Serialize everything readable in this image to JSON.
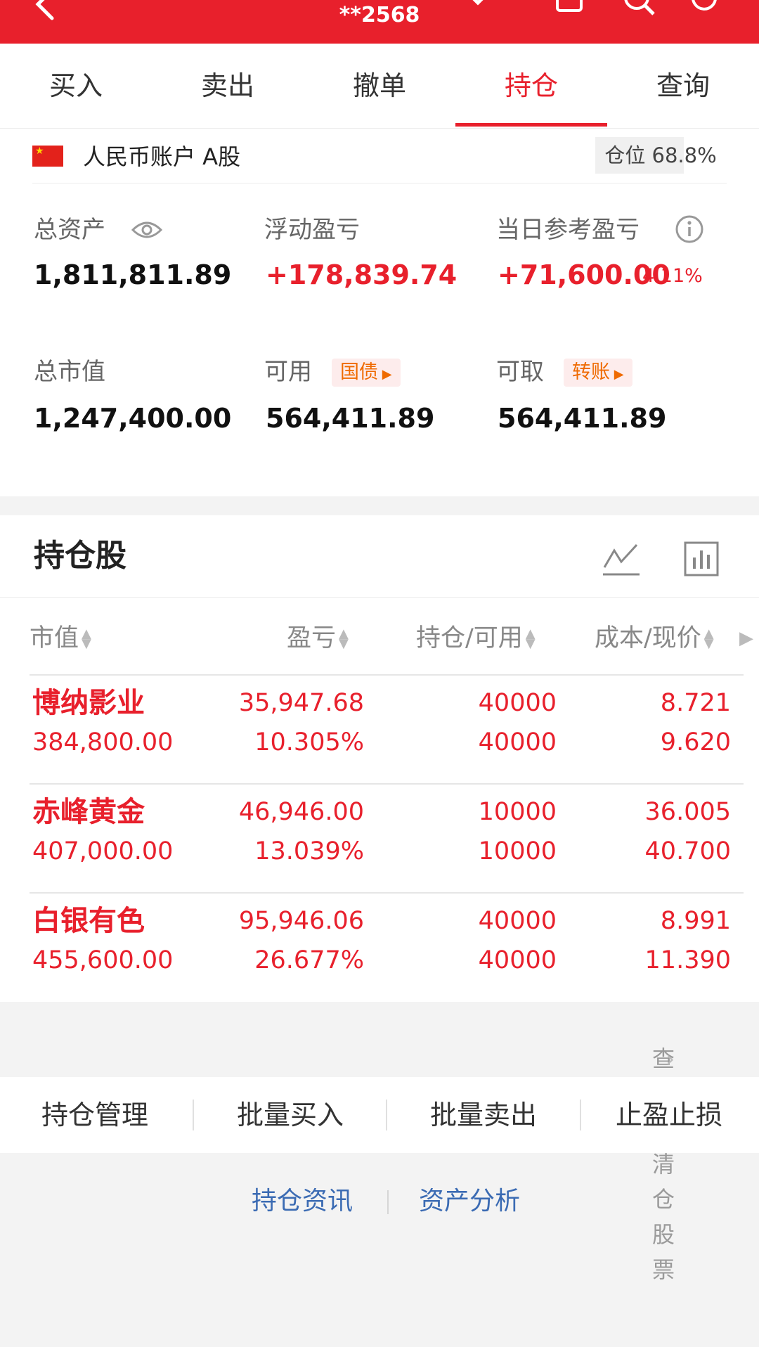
{
  "header": {
    "account_masked": "**2568",
    "icons": [
      "back-arrow-icon",
      "chevron-down-icon",
      "message-icon",
      "search-icon",
      "refresh-icon"
    ]
  },
  "tabs": [
    {
      "label": "买入"
    },
    {
      "label": "卖出"
    },
    {
      "label": "撤单"
    },
    {
      "label": "持仓",
      "active": true
    },
    {
      "label": "查询"
    }
  ],
  "account": {
    "name": "人民币账户 A股",
    "position_label": "仓位 68.8%"
  },
  "summary": {
    "total_assets_label": "总资产",
    "total_assets": "1,811,811.89",
    "floating_pl_label": "浮动盈亏",
    "floating_pl": "+178,839.74",
    "daily_pl_label": "当日参考盈亏",
    "daily_pl": "+71,600.00",
    "daily_pl_pct": "4.11%",
    "market_value_label": "总市值",
    "market_value": "1,247,400.00",
    "available_label": "可用",
    "available_tag": "国债",
    "available": "564,411.89",
    "withdrawable_label": "可取",
    "withdrawable_tag": "转账",
    "withdrawable": "564,411.89"
  },
  "holdings": {
    "title": "持仓股",
    "columns": [
      "市值",
      "盈亏",
      "持仓/可用",
      "成本/现价"
    ],
    "rows": [
      {
        "name": "博纳影业",
        "market_value": "384,800.00",
        "pl": "35,947.68",
        "pl_pct": "10.305%",
        "position": "40000",
        "available": "40000",
        "cost": "8.721",
        "price": "9.620"
      },
      {
        "name": "赤峰黄金",
        "market_value": "407,000.00",
        "pl": "46,946.00",
        "pl_pct": "13.039%",
        "position": "10000",
        "available": "10000",
        "cost": "36.005",
        "price": "40.700"
      },
      {
        "name": "白银有色",
        "market_value": "455,600.00",
        "pl": "95,946.06",
        "pl_pct": "26.677%",
        "position": "40000",
        "available": "40000",
        "cost": "8.991",
        "price": "11.390"
      }
    ],
    "cleared_link": "查看已清仓股票"
  },
  "actions": [
    "持仓管理",
    "批量买入",
    "批量卖出",
    "止盈止损"
  ],
  "links": [
    "持仓资讯",
    "资产分析"
  ],
  "colors": {
    "brand_red": "#e8202c",
    "link_blue": "#3b6bb3",
    "tag_orange": "#ef6a00"
  }
}
